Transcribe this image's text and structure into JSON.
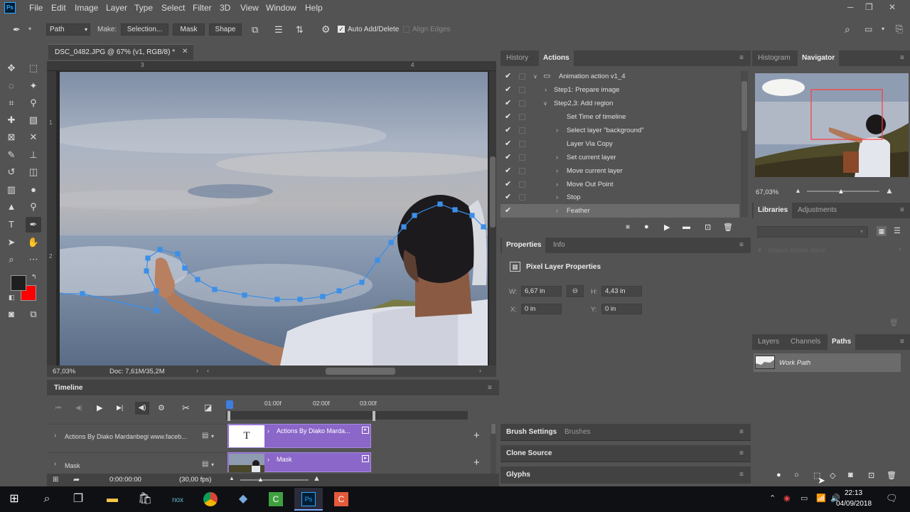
{
  "menubar": {
    "logo": "Ps",
    "items": [
      "File",
      "Edit",
      "Image",
      "Layer",
      "Type",
      "Select",
      "Filter",
      "3D",
      "View",
      "Window",
      "Help"
    ]
  },
  "options": {
    "mode": "Path",
    "make_label": "Make:",
    "selection_btn": "Selection...",
    "mask_btn": "Mask",
    "shape_btn": "Shape",
    "auto_add_delete": "Auto Add/Delete",
    "align_edges": "Align Edges"
  },
  "document": {
    "tab_title": "DSC_0482.JPG @ 67% (v1, RGB/8) *",
    "zoom": "67,03%",
    "doc_info": "Doc: 7,61M/35,2M",
    "ruler_marks": [
      "3",
      "4"
    ],
    "ruler_v_marks": [
      "1",
      "2"
    ]
  },
  "actions_panel": {
    "tabs": [
      "History",
      "Actions"
    ],
    "rows": [
      {
        "label": "Animation action v1_4",
        "type": "set"
      },
      {
        "label": "Step1: Prepare image",
        "type": "action"
      },
      {
        "label": "Step2,3: Add region",
        "type": "action-open"
      },
      {
        "label": "Set Time of timeline",
        "type": "cmd"
      },
      {
        "label": "Select layer \"background\"",
        "type": "cmd"
      },
      {
        "label": "Layer Via Copy",
        "type": "cmd-nochev"
      },
      {
        "label": "Set current layer",
        "type": "cmd"
      },
      {
        "label": "Move current layer",
        "type": "cmd"
      },
      {
        "label": "Move Out Point",
        "type": "cmd"
      },
      {
        "label": "Stop",
        "type": "cmd"
      },
      {
        "label": "Feather",
        "type": "cmd-selected"
      }
    ]
  },
  "navigator_panel": {
    "tabs": [
      "Histogram",
      "Navigator"
    ],
    "zoom": "67,03%"
  },
  "libraries_panel": {
    "tabs": [
      "Libraries",
      "Adjustments"
    ],
    "search_placeholder": "Search Adobe Stock"
  },
  "properties_panel": {
    "tabs": [
      "Properties",
      "Info"
    ],
    "heading": "Pixel Layer Properties",
    "w_label": "W:",
    "w_value": "6,67 in",
    "h_label": "H:",
    "h_value": "4,43 in",
    "x_label": "X:",
    "x_value": "0 in",
    "y_label": "Y:",
    "y_value": "0 in"
  },
  "collapsed_panels": {
    "brush_settings": "Brush Settings",
    "brushes": "Brushes",
    "clone_source": "Clone Source",
    "glyphs": "Glyphs"
  },
  "paths_panel": {
    "tabs": [
      "Layers",
      "Channels",
      "Paths"
    ],
    "item": "Work Path"
  },
  "timeline": {
    "title": "Timeline",
    "time_marks": [
      "01:00f",
      "02:00f",
      "03:00f"
    ],
    "tracks": [
      {
        "label": "Actions By  Diako Mardanbegi www.faceb...",
        "clip": "Actions By  Diako Marda..."
      },
      {
        "label": "Mask",
        "clip": "Mask"
      }
    ],
    "current_time": "0:00:00:00",
    "fps": "(30,00 fps)"
  },
  "taskbar": {
    "time": "22:13",
    "date": "04/09/2018"
  },
  "colors": {
    "foreground": "#1f1f1f",
    "background": "#ff0000",
    "path": "#3c8fe8",
    "clip": "#8b67c9"
  }
}
